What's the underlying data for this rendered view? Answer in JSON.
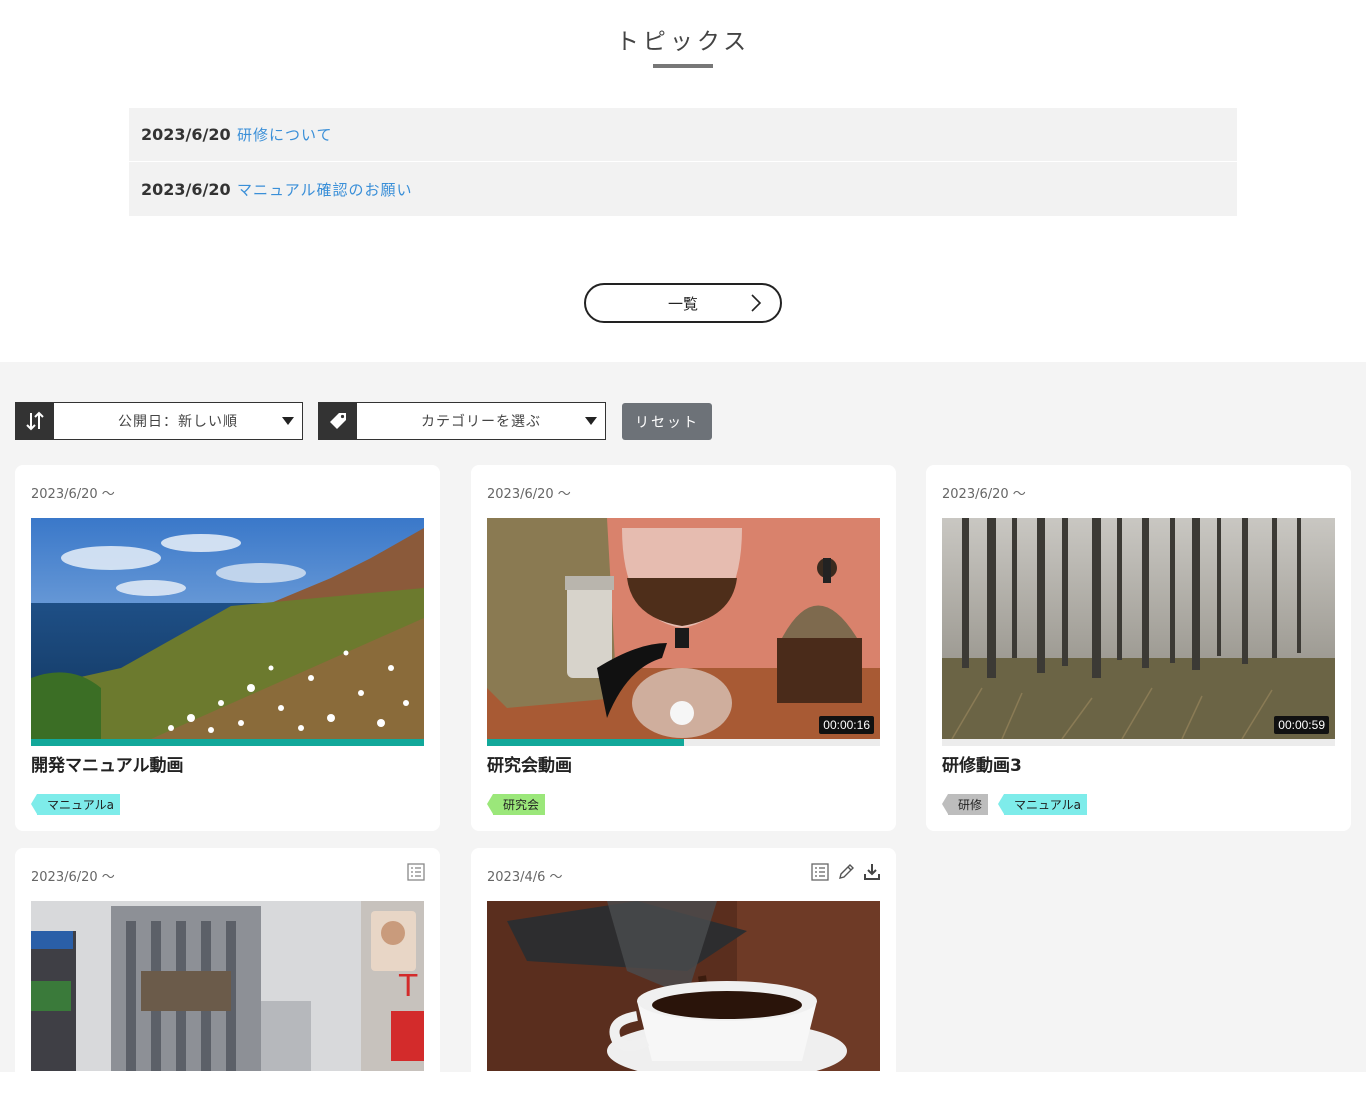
{
  "topics": {
    "title": "トピックス",
    "items": [
      {
        "date": "2023/6/20",
        "link": "研修について"
      },
      {
        "date": "2023/6/20",
        "link": "マニュアル確認のお願い"
      }
    ],
    "more_label": "一覧"
  },
  "filters": {
    "sort": {
      "icon": "sort-arrows-icon",
      "value": "公開日：新しい順"
    },
    "category": {
      "icon": "tag-icon",
      "value": "カテゴリーを選ぶ"
    },
    "reset_label": "リセット"
  },
  "colors": {
    "progress": "#12a89a",
    "tag_manual": "#7eecea",
    "tag_kenkyu": "#9be77a",
    "tag_kenshu": "#bdbdbd",
    "link": "#3a8fd8",
    "reset_bg": "#6d7278"
  },
  "cards": [
    {
      "date": "2023/6/20 〜",
      "title": "開発マニュアル動画",
      "progress": 1.0,
      "duration": "",
      "tags": [
        "マニュアルa"
      ],
      "thumbnail": "coastal-flowers"
    },
    {
      "date": "2023/6/20 〜",
      "title": "研究会動画",
      "progress": 0.5,
      "duration": "00:00:16",
      "tags": [
        "研究会"
      ],
      "thumbnail": "coffee-siphon"
    },
    {
      "date": "2023/6/20 〜",
      "title": "研修動画3",
      "progress": 0,
      "duration": "00:00:59",
      "tags": [
        "研修",
        "マニュアルa"
      ],
      "thumbnail": "foggy-forest"
    },
    {
      "date": "2023/6/20 〜",
      "actions": [
        "list-icon"
      ],
      "thumbnail": "city-building"
    },
    {
      "date": "2023/4/6 〜",
      "actions": [
        "list-icon",
        "pencil-icon",
        "download-icon"
      ],
      "thumbnail": "coffee-pour"
    }
  ]
}
